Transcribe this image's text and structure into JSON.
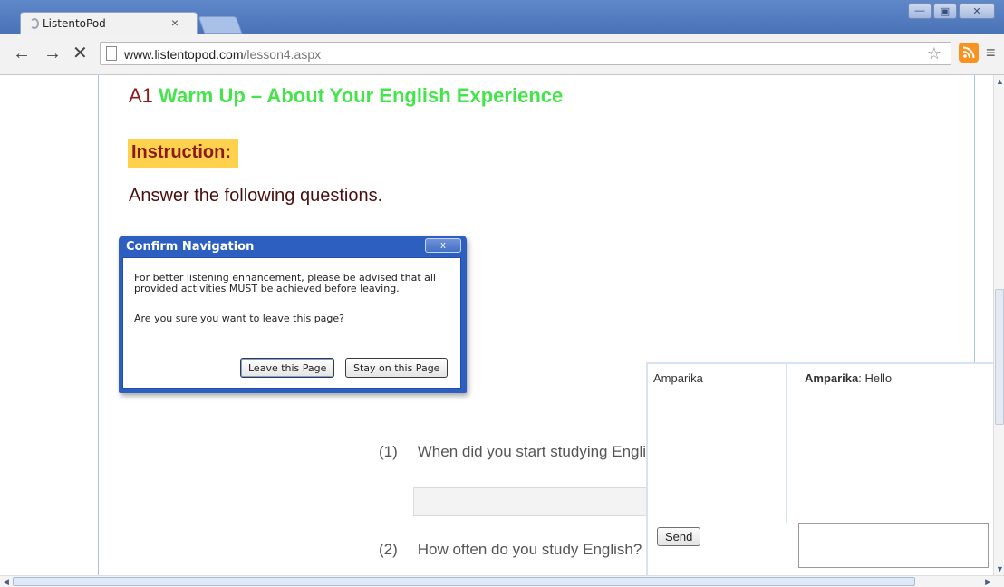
{
  "browser": {
    "tab_title": "ListentoPod",
    "tab_close": "×",
    "url_host": "www.listentopod.com",
    "url_path": "/lesson4.aspx",
    "window_buttons": {
      "minimize": "—",
      "maximize": "▣",
      "close": "✕"
    },
    "nav_back": "←",
    "nav_forward": "→",
    "nav_stop": "✕",
    "star": "☆",
    "menu": "≡"
  },
  "page": {
    "heading_prefix": "A1",
    "heading_title": "Warm Up – About Your English Experience",
    "instruction_label": "Instruction:",
    "answer_prompt": "Answer the following questions.",
    "questions": [
      {
        "num": "(1)",
        "text": "When did you start studying English?"
      },
      {
        "num": "(2)",
        "text": "How often do you study English?"
      }
    ]
  },
  "dialog": {
    "title": "Confirm Navigation",
    "close": "x",
    "message": "For better listening enhancement, please be advised that all provided activities MUST be achieved before leaving.",
    "question": "Are you sure you want to leave this page?",
    "leave_button": "Leave this Page",
    "stay_button": "Stay on this Page"
  },
  "chat": {
    "user_name": "Amparika",
    "message_sender": "Amparika",
    "message_text": ": Hello",
    "send_label": "Send"
  },
  "colors": {
    "heading_prefix": "#8b1a1a",
    "heading_title": "#44e44a",
    "instruction_bg": "#ffd24d",
    "dialog_frame": "#2d5fc1"
  },
  "icons": [
    "spinner-icon",
    "page-icon",
    "star-icon",
    "rss-icon",
    "menu-icon",
    "back-icon",
    "forward-icon",
    "stop-icon"
  ]
}
